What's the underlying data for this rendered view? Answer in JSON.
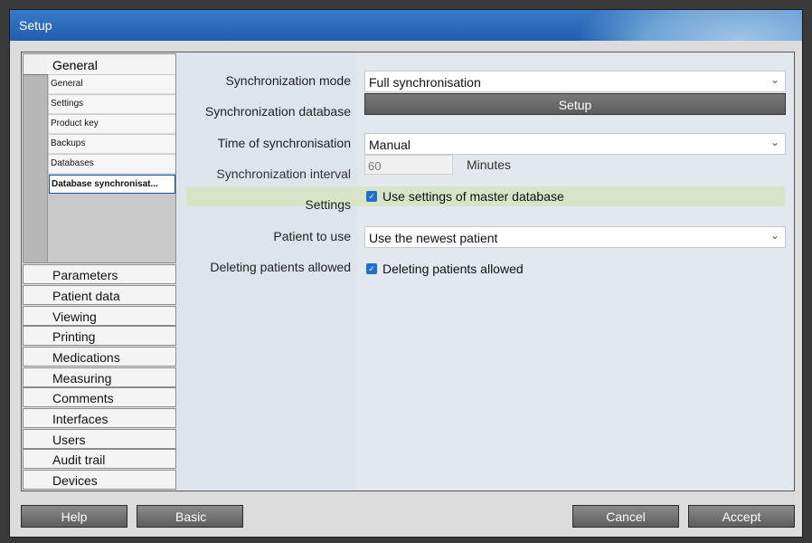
{
  "window": {
    "title": "Setup"
  },
  "nav": {
    "general": {
      "label": "General",
      "items": [
        "General",
        "Settings",
        "Product key",
        "Backups",
        "Databases",
        "Database synchronisat..."
      ]
    },
    "sections": [
      "Parameters",
      "Patient data",
      "Viewing",
      "Printing",
      "Medications",
      "Measuring",
      "Comments",
      "Interfaces",
      "Users",
      "Audit trail",
      "Devices"
    ]
  },
  "form": {
    "sync_mode": {
      "label": "Synchronization mode",
      "value": "Full synchronisation"
    },
    "sync_db": {
      "label": "Synchronization database",
      "button": "Setup"
    },
    "sync_time": {
      "label": "Time of synchronisation",
      "value": "Manual"
    },
    "sync_interval": {
      "label": "Synchronization interval",
      "value": "60",
      "unit": "Minutes"
    },
    "settings": {
      "label": "Settings",
      "checkbox": "Use settings of master database",
      "checked": true
    },
    "patient": {
      "label": "Patient to use",
      "value": "Use the newest patient"
    },
    "deleting": {
      "label": "Deleting patients allowed",
      "checkbox": "Deleting patients allowed",
      "checked": true
    }
  },
  "buttons": {
    "help": "Help",
    "basic": "Basic",
    "cancel": "Cancel",
    "accept": "Accept"
  },
  "icons": {
    "chevron": "chevron-down-icon",
    "check": "check-icon"
  }
}
